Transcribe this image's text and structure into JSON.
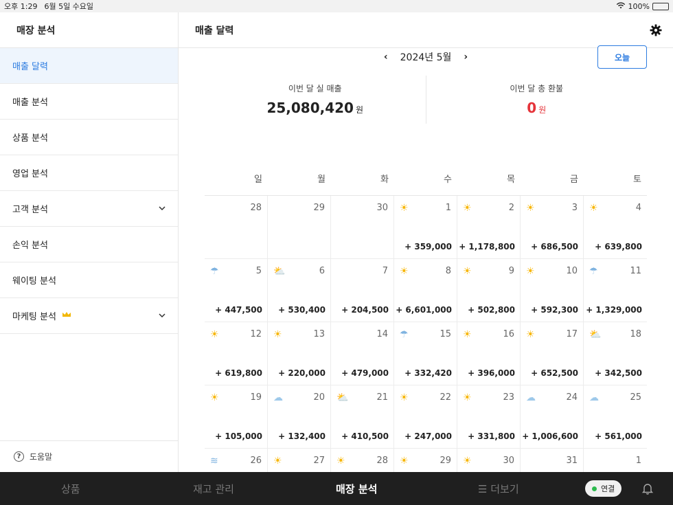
{
  "status": {
    "time": "오후 1:29",
    "date": "6월 5일 수요일",
    "battery": "100%"
  },
  "sidebar": {
    "title": "매장 분석",
    "items": [
      {
        "label": "매출 달력",
        "active": true
      },
      {
        "label": "매출 분석"
      },
      {
        "label": "상품 분석"
      },
      {
        "label": "영업 분석"
      },
      {
        "label": "고객 분석",
        "expandable": true
      },
      {
        "label": "손익 분석"
      },
      {
        "label": "웨이팅 분석"
      },
      {
        "label": "마케팅 분석",
        "expandable": true,
        "badge": "crown-icon"
      }
    ],
    "help": "도움말"
  },
  "header": {
    "title": "매출 달력"
  },
  "calendar_nav": {
    "month": "2024년 5월",
    "today_button": "오늘"
  },
  "summary": {
    "sales_label": "이번 달 실 매출",
    "sales_value": "25,080,420",
    "sales_unit": "원",
    "refund_label": "이번 달 총 환불",
    "refund_value": "0",
    "refund_unit": "원"
  },
  "weekdays": [
    "일",
    "월",
    "화",
    "수",
    "목",
    "금",
    "토"
  ],
  "days": [
    {
      "d": "28",
      "w": "",
      "a": ""
    },
    {
      "d": "29",
      "w": "",
      "a": ""
    },
    {
      "d": "30",
      "w": "",
      "a": ""
    },
    {
      "d": "1",
      "w": "sun",
      "a": "+ 359,000"
    },
    {
      "d": "2",
      "w": "sun",
      "a": "+ 1,178,800"
    },
    {
      "d": "3",
      "w": "sun",
      "a": "+ 686,500"
    },
    {
      "d": "4",
      "w": "sun",
      "a": "+ 639,800"
    },
    {
      "d": "5",
      "w": "rain",
      "a": "+ 447,500"
    },
    {
      "d": "6",
      "w": "partly",
      "a": "+ 530,400"
    },
    {
      "d": "7",
      "w": "",
      "a": "+ 204,500"
    },
    {
      "d": "8",
      "w": "sun",
      "a": "+ 6,601,000"
    },
    {
      "d": "9",
      "w": "sun",
      "a": "+ 502,800"
    },
    {
      "d": "10",
      "w": "sun",
      "a": "+ 592,300"
    },
    {
      "d": "11",
      "w": "rain",
      "a": "+ 1,329,000"
    },
    {
      "d": "12",
      "w": "sun",
      "a": "+ 619,800"
    },
    {
      "d": "13",
      "w": "sun",
      "a": "+ 220,000"
    },
    {
      "d": "14",
      "w": "",
      "a": "+ 479,000"
    },
    {
      "d": "15",
      "w": "rain",
      "a": "+ 332,420"
    },
    {
      "d": "16",
      "w": "sun",
      "a": "+ 396,000"
    },
    {
      "d": "17",
      "w": "sun",
      "a": "+ 652,500"
    },
    {
      "d": "18",
      "w": "partly",
      "a": "+ 342,500"
    },
    {
      "d": "19",
      "w": "sun",
      "a": "+ 105,000"
    },
    {
      "d": "20",
      "w": "cloud",
      "a": "+ 132,400"
    },
    {
      "d": "21",
      "w": "partly",
      "a": "+ 410,500"
    },
    {
      "d": "22",
      "w": "sun",
      "a": "+ 247,000"
    },
    {
      "d": "23",
      "w": "sun",
      "a": "+ 331,800"
    },
    {
      "d": "24",
      "w": "cloud",
      "a": "+ 1,006,600"
    },
    {
      "d": "25",
      "w": "cloud",
      "a": "+ 561,000"
    },
    {
      "d": "26",
      "w": "haze",
      "a": ""
    },
    {
      "d": "27",
      "w": "sun",
      "a": ""
    },
    {
      "d": "28",
      "w": "sun",
      "a": ""
    },
    {
      "d": "29",
      "w": "sun",
      "a": ""
    },
    {
      "d": "30",
      "w": "sun",
      "a": ""
    },
    {
      "d": "31",
      "w": "",
      "a": ""
    },
    {
      "d": "1",
      "w": "",
      "a": ""
    }
  ],
  "tabbar": {
    "tabs": [
      {
        "label": "상품"
      },
      {
        "label": "재고 관리"
      },
      {
        "label": "매장 분석",
        "active": true
      },
      {
        "label": "더보기"
      }
    ],
    "connection": "연결"
  },
  "colors": {
    "accent": "#2b7be0",
    "refund": "#e5343a",
    "tabbar": "#1f1f1f"
  }
}
